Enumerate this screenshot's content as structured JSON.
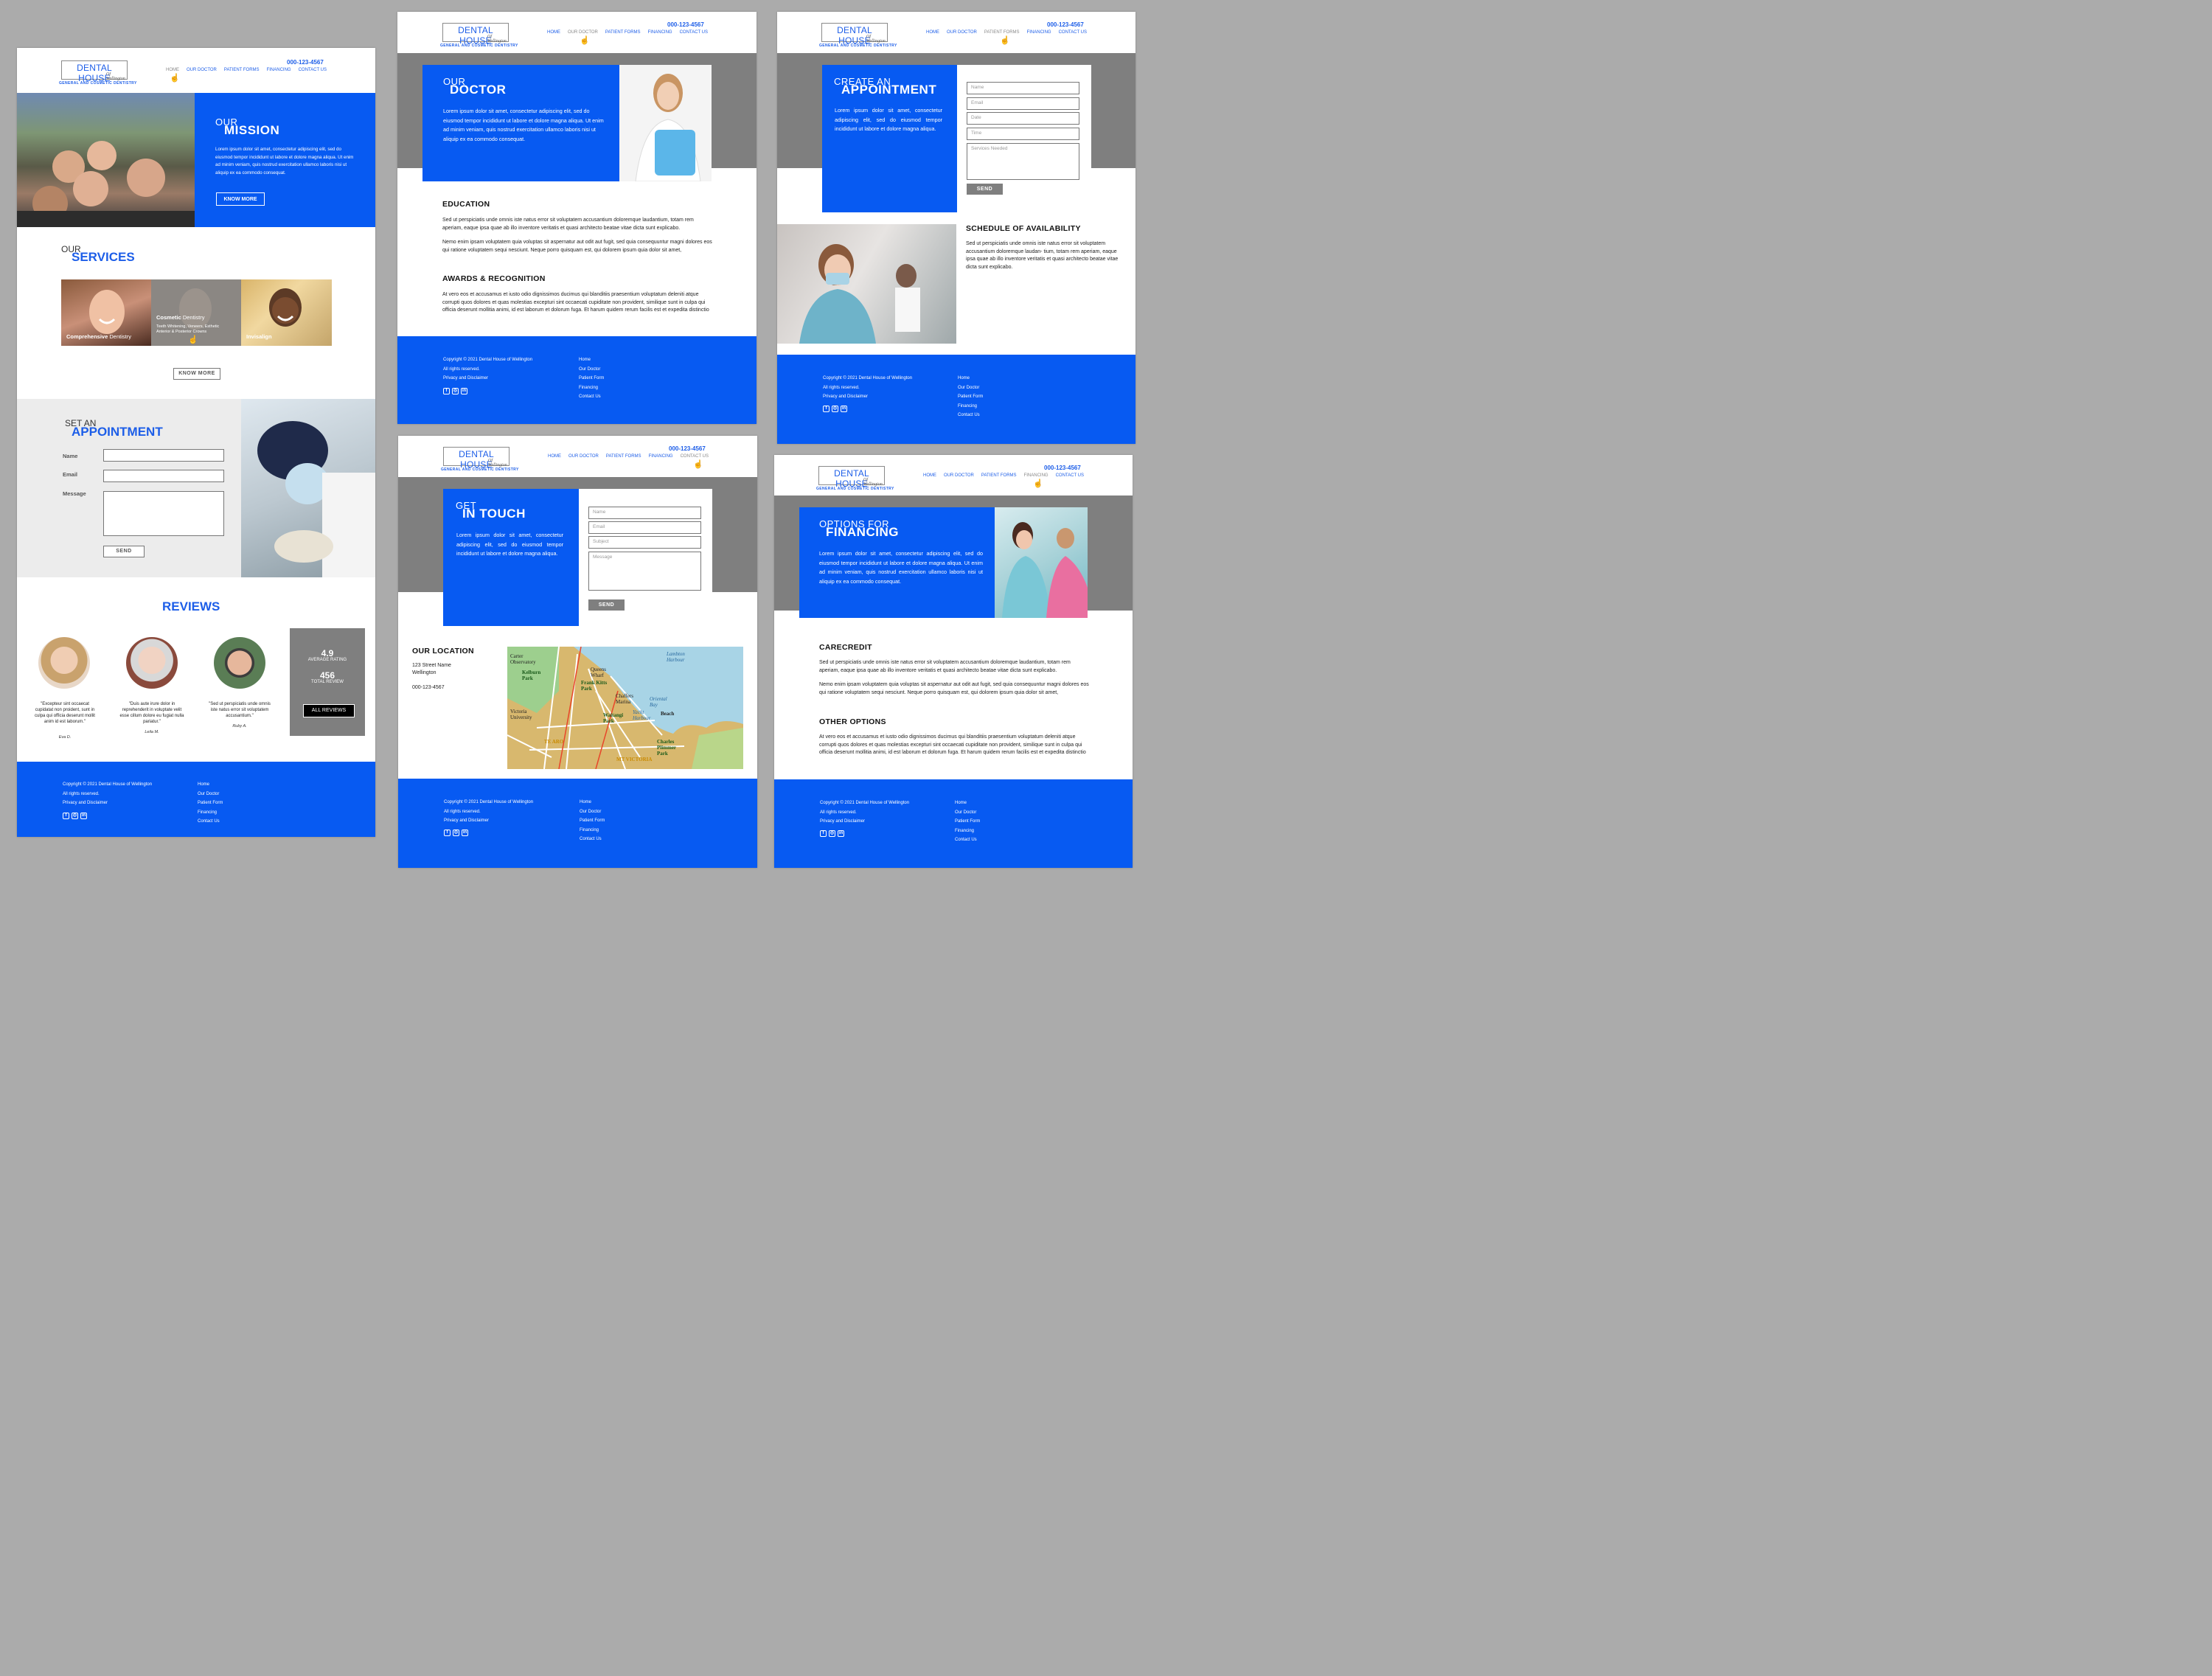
{
  "brand": {
    "name": "DENTAL HOUSE",
    "script": "Of Wellington",
    "tagline": "GENERAL AND COSMETIC DENTISTRY",
    "phone": "000-123-4567"
  },
  "nav": [
    "HOME",
    "OUR DOCTOR",
    "PATIENT FORMS",
    "FINANCING",
    "CONTACT US"
  ],
  "footer": {
    "copyright": "Copyright © 2021 Dental House of Wellington",
    "rights": "All rights reserved.",
    "privacy": "Privacy and Disclaimer",
    "links": [
      "Home",
      "Our Doctor",
      "Patient Form",
      "Financing",
      "Contact Us"
    ]
  },
  "home": {
    "mission": {
      "small": "OUR",
      "big": "MISSION",
      "text": "Lorem ipsum dolor sit amet, consectetur adipiscing elit, sed do eiusmod tempor incididunt ut labore et dolore magna aliqua. Ut enim ad minim veniam, quis nostrud exercitation ullamco laboris nisi ut aliquip ex ea commodo consequat.",
      "button": "KNOW MORE"
    },
    "services": {
      "small": "OUR",
      "big": "SERVICES",
      "items": [
        {
          "title_bold": "Comprehensive",
          "title_rest": " Dentistry",
          "detail": ""
        },
        {
          "title_bold": "Cosmetic",
          "title_rest": " Dentistry",
          "detail": "Teeth Whitening, Veneers, Esthetic Anterior & Posterior Crowns"
        },
        {
          "title_bold": "Invisalign",
          "title_rest": "",
          "detail": ""
        }
      ],
      "button": "KNOW MORE"
    },
    "appointment": {
      "small": "SET AN",
      "big": "APPOINTMENT",
      "name": "Name",
      "email": "Email",
      "message": "Message",
      "button": "SEND"
    },
    "reviews": {
      "title": "REVIEWS",
      "items": [
        {
          "quote": "\"Excepteur sint occaecat cupidatat non proident, sunt in culpa qui officia deserunt mollit anim id est laborum.\"",
          "author": "Eva D."
        },
        {
          "quote": "\"Duis aute irure dolor in reprehenderit in voluptate velit esse cillum dolore eu fugiat nulla pariatur.\"",
          "author": "Leila M."
        },
        {
          "quote": "\"Sed ut perspiciatis unde omnis iste natus error sit voluptatem accusantium.\"",
          "author": "Ruby A."
        }
      ],
      "rating": "4.9",
      "rating_label": "AVERAGE RATING",
      "total": "456",
      "total_label": "TOTAL REVIEW",
      "button": "ALL REVIEWS"
    }
  },
  "doctor": {
    "small": "OUR",
    "big": "DOCTOR",
    "text": "Lorem ipsum dolor sit amet, consectetur adipiscing elit, sed do eiusmod tempor incididunt ut labore et dolore magna aliqua. Ut enim ad minim veniam, quis nostrud exercitation ullamco laboris nisi ut aliquip ex ea commodo consequat.",
    "education_title": "EDUCATION",
    "education_p1": "Sed ut perspiciatis unde omnis iste natus error sit voluptatem accusantium doloremque laudantium, totam rem aperiam, eaque ipsa quae ab illo inventore veritatis et quasi architecto beatae vitae dicta sunt explicabo.",
    "education_p2": "Nemo enim ipsam voluptatem quia voluptas sit aspernatur aut odit aut fugit, sed quia consequuntur magni dolores eos qui ratione voluptatem sequi nesciunt. Neque porro quisquam est, qui dolorem ipsum quia dolor sit amet,",
    "awards_title": "AWARDS & RECOGNITION",
    "awards_p": "At vero eos et accusamus et iusto odio dignissimos ducimus qui blanditiis praesentium voluptatum deleniti atque corrupti quos dolores et quas molestias excepturi sint occaecati cupiditate non provident, similique sunt in culpa qui officia deserunt mollitia animi, id est laborum et dolorum fuga. Et harum quidem rerum facilis est et expedita distinctio"
  },
  "forms": {
    "small": "CREATE AN",
    "big": "APPOINTMENT",
    "text": "Lorem ipsum dolor sit amet, consectetur adipiscing elit, sed do eiusmod tempor incididunt ut labore et dolore magna aliqua.",
    "fields": [
      "Name",
      "Email",
      "Date",
      "Time",
      "Services Needed"
    ],
    "button": "SEND",
    "schedule_title": "SCHEDULE OF AVAILABILITY",
    "schedule_text": "Sed ut perspiciatis unde omnis iste natus error sit voluptatem accusantium doloremque laudan- tium, totam rem aperiam, eaque ipsa quae ab illo inventore veritatis et quasi architecto beatae vitae dicta sunt explicabo."
  },
  "contact": {
    "small": "GET",
    "big": "IN TOUCH",
    "text": "Lorem ipsum dolor sit amet, consectetur adipiscing elit, sed do eiusmod tempor incididunt ut labore et dolore magna aliqua.",
    "fields": [
      "Name",
      "Email",
      "Subject",
      "Message"
    ],
    "button": "SEND",
    "location_title": "OUR LOCATION",
    "street": "123 Street Name",
    "city": "Wellington",
    "phone": "000-123-4567",
    "map_labels": [
      "Carter Observatory",
      "Kelburn Park",
      "Victoria University",
      "The Terrace",
      "Queens Wharf",
      "Frank Kitts Park",
      "Chaffers Marina",
      "Oriental Bay",
      "Yacht Harbour",
      "Waitangi Park",
      "Beach",
      "Lambton Harbour",
      "Charles Plimmer Park",
      "TE ARO",
      "MT VICTORIA",
      "Cuba St",
      "Willis St",
      "Taranaki St",
      "Vivian St",
      "Kent Tce",
      "Cable St",
      "Wakefield St",
      "Ghuznee St"
    ]
  },
  "financing": {
    "small": "OPTIONS FOR",
    "big": "FINANCING",
    "text": "Lorem ipsum dolor sit amet, consectetur adipiscing elit, sed do eiusmod tempor incididunt ut labore et dolore magna aliqua. Ut enim ad minim veniam, quis nostrud exercitation ullamco laboris nisi ut aliquip ex ea commodo consequat.",
    "care_title": "CARECREDIT",
    "care_p1": "Sed ut perspiciatis unde omnis iste natus error sit voluptatem accusantium doloremque laudantium, totam rem aperiam, eaque ipsa quae ab illo inventore veritatis et quasi architecto beatae vitae dicta sunt explicabo.",
    "care_p2": "Nemo enim ipsam voluptatem quia voluptas sit aspernatur aut odit aut fugit, sed quia consequuntur magni dolores eos qui ratione voluptatem sequi nesciunt. Neque porro quisquam est, qui dolorem ipsum quia dolor sit amet,",
    "other_title": "OTHER OPTIONS",
    "other_p": "At vero eos et accusamus et iusto odio dignissimos ducimus qui blanditiis praesentium voluptatum deleniti atque corrupti quos dolores et quas molestias excepturi sint occaecati cupiditate non provident, similique sunt in culpa qui officia deserunt mollitia animi, id est laborum et dolorum fuga. Et harum quidem rerum facilis est et expedita distinctio"
  },
  "colors": {
    "brand_blue": "#075af2",
    "gray_panel": "#7f7f7f",
    "backdrop": "#ababab"
  },
  "icons": [
    "facebook-icon",
    "instagram-icon",
    "linkedin-icon",
    "hand-cursor-icon"
  ]
}
